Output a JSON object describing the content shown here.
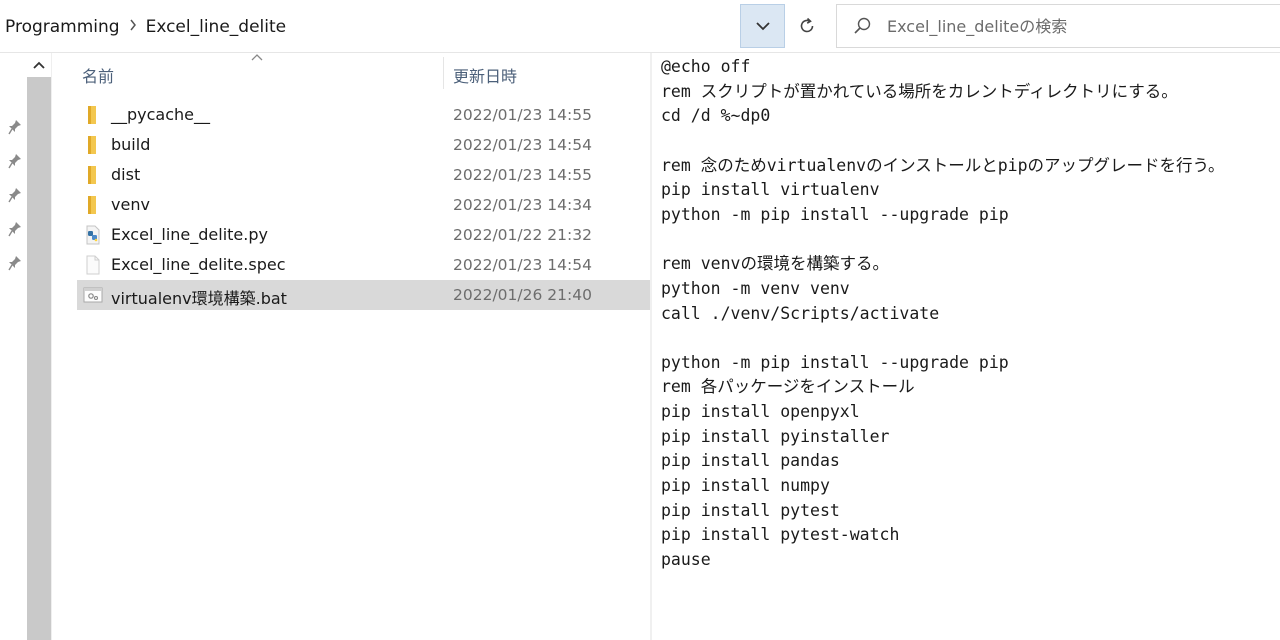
{
  "address_bar": {
    "breadcrumbs": [
      "Programming",
      "Excel_line_delite"
    ],
    "separator": ">"
  },
  "search": {
    "placeholder": "Excel_line_deliteの検索"
  },
  "file_list": {
    "columns": {
      "name": "名前",
      "date": "更新日時"
    },
    "files": [
      {
        "name": "__pycache__",
        "date": "2022/01/23 14:55",
        "icon": "folder-icon",
        "selected": false
      },
      {
        "name": "build",
        "date": "2022/01/23 14:54",
        "icon": "folder-icon",
        "selected": false
      },
      {
        "name": "dist",
        "date": "2022/01/23 14:55",
        "icon": "folder-icon",
        "selected": false
      },
      {
        "name": "venv",
        "date": "2022/01/23 14:34",
        "icon": "folder-icon",
        "selected": false
      },
      {
        "name": "Excel_line_delite.py",
        "date": "2022/01/22 21:32",
        "icon": "python-file-icon",
        "selected": false
      },
      {
        "name": "Excel_line_delite.spec",
        "date": "2022/01/23 14:54",
        "icon": "file-icon",
        "selected": false
      },
      {
        "name": "virtualenv環境構築.bat",
        "date": "2022/01/26 21:40",
        "icon": "batch-file-icon",
        "selected": true
      }
    ]
  },
  "preview": {
    "lines": [
      "@echo off",
      "rem スクリプトが置かれている場所をカレントディレクトリにする。",
      "cd /d %~dp0",
      "",
      "rem 念のためvirtualenvのインストールとpipのアップグレードを行う。",
      "pip install virtualenv",
      "python -m pip install --upgrade pip",
      "",
      "rem venvの環境を構築する。",
      "python -m venv venv",
      "call ./venv/Scripts/activate",
      "",
      "python -m pip install --upgrade pip",
      "rem 各パッケージをインストール",
      "pip install openpyxl",
      "pip install pyinstaller",
      "pip install pandas",
      "pip install numpy",
      "pip install pytest",
      "pip install pytest-watch",
      "pause"
    ]
  },
  "nav_pane": {
    "pins": [
      "pin-icon",
      "pin-icon",
      "pin-icon",
      "pin-icon",
      "pin-icon"
    ]
  },
  "colors": {
    "selected_row": "#d9d9d9",
    "dropdown_active": "#dbe7f3",
    "folder": "#f3c74f",
    "header_text": "#4c607a"
  }
}
